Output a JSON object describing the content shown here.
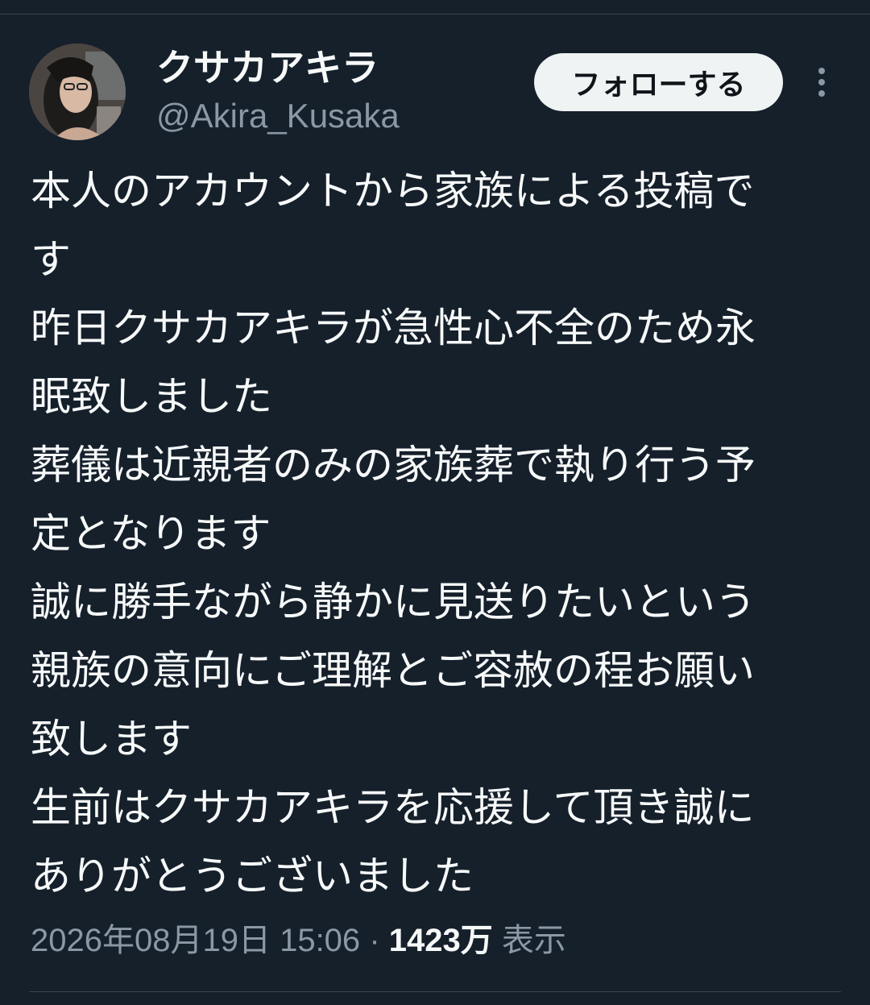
{
  "user": {
    "display_name": "クサカアキラ",
    "handle": "@Akira_Kusaka"
  },
  "actions": {
    "follow_label": "フォローする",
    "more_icon": "more-vertical-icon"
  },
  "tweet": {
    "lines": [
      "本人のアカウントから家族による投稿で",
      "す",
      "昨日クサカアキラが急性心不全のため永",
      "眠致しました",
      "葬儀は近親者のみの家族葬で執り行う予",
      "定となります",
      "誠に勝手ながら静かに見送りたいという",
      "親族の意向にご理解とご容赦の程お願い",
      "致します",
      "生前はクサカアキラを応援して頂き誠に",
      "ありがとうございました"
    ]
  },
  "meta": {
    "timestamp": "2026年08月19日 15:06",
    "separator": "·",
    "views_count": "1423万",
    "views_label": "表示"
  },
  "colors": {
    "background": "#15202b",
    "primary_text": "#f7f9f9",
    "secondary_text": "#8b98a5",
    "divider": "#38444d",
    "follow_bg": "#eff3f4"
  }
}
